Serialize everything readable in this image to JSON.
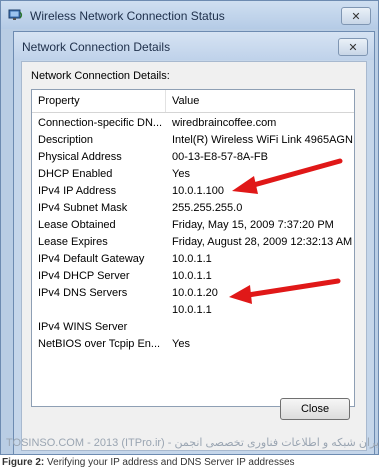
{
  "outer_window": {
    "title": "Wireless Network Connection Status",
    "close_label": "✕"
  },
  "dialog": {
    "title": "Network Connection Details",
    "close_label": "✕",
    "group_label": "Network Connection Details:",
    "columns": {
      "property": "Property",
      "value": "Value"
    },
    "rows": [
      {
        "property": "Connection-specific DN...",
        "value": "wiredbraincoffee.com"
      },
      {
        "property": "Description",
        "value": "Intel(R) Wireless WiFi Link 4965AGN"
      },
      {
        "property": "Physical Address",
        "value": "00-13-E8-57-8A-FB"
      },
      {
        "property": "DHCP Enabled",
        "value": "Yes"
      },
      {
        "property": "IPv4 IP Address",
        "value": "10.0.1.100"
      },
      {
        "property": "IPv4 Subnet Mask",
        "value": "255.255.255.0"
      },
      {
        "property": "Lease Obtained",
        "value": "Friday, May 15, 2009 7:37:20 PM"
      },
      {
        "property": "Lease Expires",
        "value": "Friday, August 28, 2009 12:32:13 AM"
      },
      {
        "property": "IPv4 Default Gateway",
        "value": "10.0.1.1"
      },
      {
        "property": "IPv4 DHCP Server",
        "value": "10.0.1.1"
      },
      {
        "property": "IPv4 DNS Servers",
        "value": "10.0.1.20"
      },
      {
        "property": "",
        "value": "10.0.1.1"
      },
      {
        "property": "IPv4 WINS Server",
        "value": ""
      },
      {
        "property": "NetBIOS over Tcpip En...",
        "value": "Yes"
      }
    ],
    "close_button": "Close"
  },
  "watermark": "TOSINSO.COM - 2013 (ITPro.ir) - ایران  شبکه  و  اطلاعات  فناوری  تخصصی  انجمن",
  "caption": {
    "label": "Figure 2:",
    "text": " Verifying your IP address and DNS Server IP addresses"
  },
  "colors": {
    "annotation_arrow": "#e01818",
    "window_frame": "#b9cde4"
  },
  "icons": {
    "window_icon": "network-connection-icon",
    "close_icon": "close-icon",
    "annotation": "red-arrow-icon"
  }
}
